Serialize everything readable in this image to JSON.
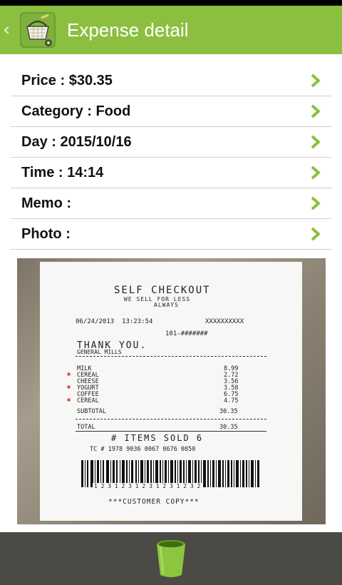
{
  "app": {
    "title": "Expense detail",
    "back_glyph": "‹",
    "icon": "shopping-basket-icon"
  },
  "details": [
    {
      "label": "Price : $30.35"
    },
    {
      "label": "Category : Food"
    },
    {
      "label": "Day : 2015/10/16"
    },
    {
      "label": "Time : 14:14"
    },
    {
      "label": "Memo :"
    },
    {
      "label": "Photo :"
    }
  ],
  "receipt": {
    "header": "SELF CHECKOUT",
    "tagline1": "WE SELL FOR LESS",
    "tagline2": "ALWAYS",
    "datetime": "06/24/2013  13:23:54",
    "ref": "XXXXXXXXXX",
    "store": "101-#######",
    "thanks": "THANK YOU.",
    "brand": "GENERAL MILLS",
    "items": [
      {
        "name": "MILK",
        "price": "8.99",
        "marked": false
      },
      {
        "name": "CEREAL",
        "price": "2.72",
        "marked": true
      },
      {
        "name": "CHEESE",
        "price": "3.56",
        "marked": false
      },
      {
        "name": "YOGURT",
        "price": "3.58",
        "marked": true
      },
      {
        "name": "COFFEE",
        "price": "6.75",
        "marked": false
      },
      {
        "name": "CEREAL",
        "price": "4.75",
        "marked": true
      }
    ],
    "subtotal_label": "SUBTOTAL",
    "subtotal": "30.35",
    "total_label": "TOTAL",
    "total": "30.35",
    "items_sold": "# ITEMS SOLD 6",
    "tc": "TC # 1978 9036 0067 0676 0850",
    "barcode_number": "1 2 3 1 2 3 1 2 3 1 2 3 1 2 3 2",
    "footer": "***CUSTOMER COPY***"
  },
  "actions": {
    "delete_icon": "trash-icon"
  },
  "colors": {
    "accent": "#8cbf3f",
    "bottom_bar": "#4b4a45",
    "chevron": "#8cbf3f",
    "marker": "#d83030"
  }
}
